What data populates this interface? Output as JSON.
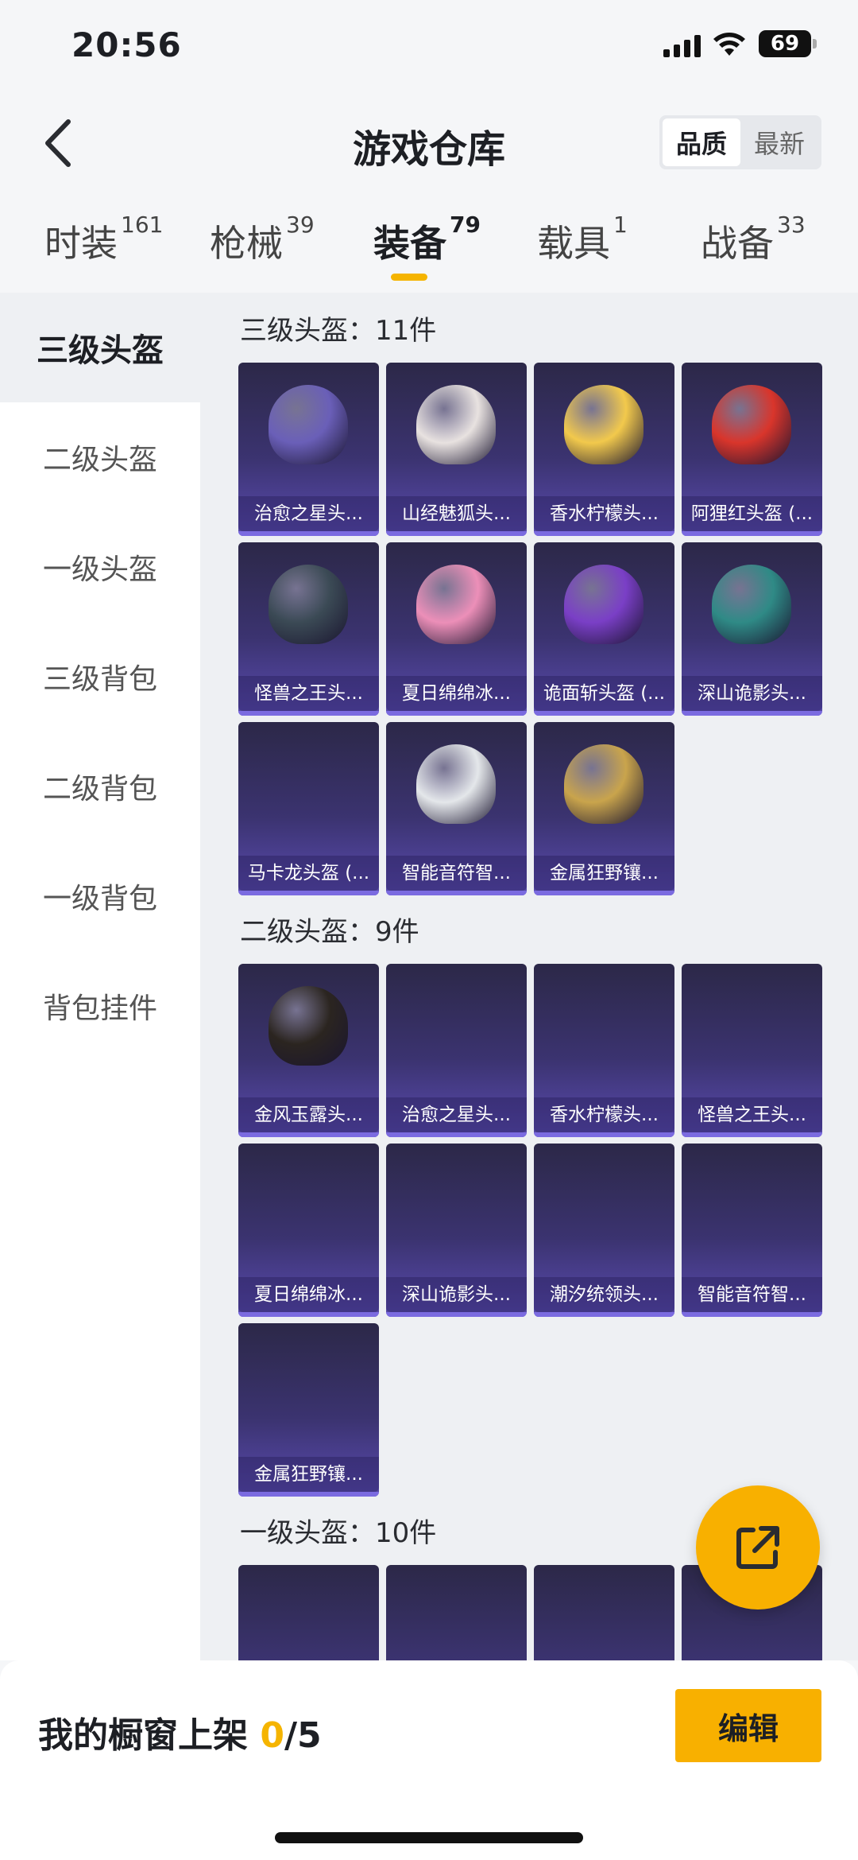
{
  "status_bar": {
    "time": "20:56",
    "battery": "69"
  },
  "header": {
    "title": "游戏仓库",
    "sort_options": [
      "品质",
      "最新"
    ],
    "sort_active": "品质"
  },
  "tabs": [
    {
      "label": "时装",
      "count": "161"
    },
    {
      "label": "枪械",
      "count": "39"
    },
    {
      "label": "装备",
      "count": "79"
    },
    {
      "label": "载具",
      "count": "1"
    },
    {
      "label": "战备",
      "count": "33"
    }
  ],
  "active_tab": "装备",
  "sidebar": {
    "items": [
      "三级头盔",
      "二级头盔",
      "一级头盔",
      "三级背包",
      "二级背包",
      "一级背包",
      "背包挂件"
    ],
    "active": "三级头盔"
  },
  "sections": [
    {
      "title": "三级头盔：11件",
      "items": [
        {
          "name": "治愈之星头...",
          "icon": "helmet-icon",
          "color": "#6a5fb8"
        },
        {
          "name": "山经魅狐头...",
          "icon": "helmet-icon",
          "color": "#e8e2e0"
        },
        {
          "name": "香水柠檬头...",
          "icon": "helmet-icon",
          "color": "#f2c94c"
        },
        {
          "name": "阿狸红头盔 (...",
          "icon": "helmet-icon",
          "color": "#d9352b"
        },
        {
          "name": "怪兽之王头...",
          "icon": "helmet-icon",
          "color": "#3b4a55"
        },
        {
          "name": "夏日绵绵冰...",
          "icon": "helmet-icon",
          "color": "#ec8fb8"
        },
        {
          "name": "诡面斩头盔 (...",
          "icon": "helmet-icon",
          "color": "#7a3fc6"
        },
        {
          "name": "深山诡影头...",
          "icon": "helmet-icon",
          "color": "#2f8a86"
        },
        {
          "name": "马卡龙头盔 (...",
          "icon": "",
          "color": ""
        },
        {
          "name": "智能音符智...",
          "icon": "helmet-icon",
          "color": "#e4e7ea"
        },
        {
          "name": "金属狂野镶...",
          "icon": "helmet-icon",
          "color": "#c9a44c"
        }
      ]
    },
    {
      "title": "二级头盔：9件",
      "items": [
        {
          "name": "金风玉露头...",
          "icon": "helmet-icon",
          "color": "#2b2520"
        },
        {
          "name": "治愈之星头...",
          "icon": "",
          "color": ""
        },
        {
          "name": "香水柠檬头...",
          "icon": "",
          "color": ""
        },
        {
          "name": "怪兽之王头...",
          "icon": "",
          "color": ""
        },
        {
          "name": "夏日绵绵冰...",
          "icon": "",
          "color": ""
        },
        {
          "name": "深山诡影头...",
          "icon": "",
          "color": ""
        },
        {
          "name": "潮汐统领头...",
          "icon": "",
          "color": ""
        },
        {
          "name": "智能音符智...",
          "icon": "",
          "color": ""
        },
        {
          "name": "金属狂野镶...",
          "icon": "",
          "color": ""
        }
      ]
    },
    {
      "title": "一级头盔：10件",
      "items": [
        {
          "name": "",
          "icon": "",
          "color": ""
        },
        {
          "name": "",
          "icon": "",
          "color": ""
        },
        {
          "name": "",
          "icon": "",
          "color": ""
        },
        {
          "name": "",
          "icon": "",
          "color": ""
        }
      ]
    }
  ],
  "bottom": {
    "showcase_label": "我的橱窗上架",
    "showcase_count": "0",
    "showcase_total": "/5",
    "edit_label": "编辑"
  },
  "colors": {
    "accent": "#f8b000",
    "card_top": "#2c2848",
    "card_bottom": "#5a4bb0"
  }
}
